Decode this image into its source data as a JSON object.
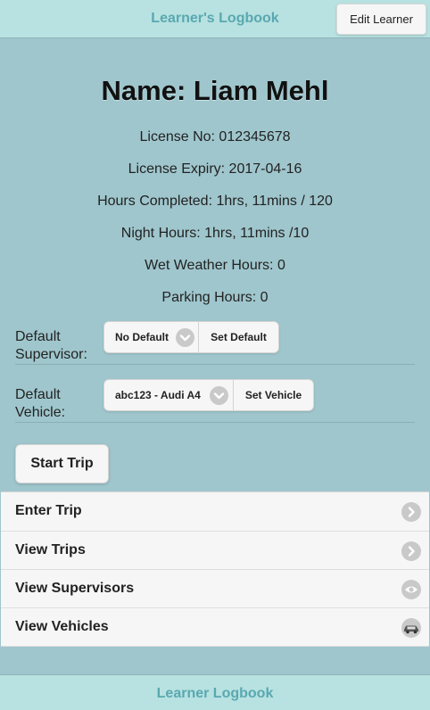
{
  "header": {
    "title": "Learner's Logbook",
    "edit_button": "Edit Learner"
  },
  "profile": {
    "name": "Name: Liam Mehl",
    "license_no": "License No: 012345678",
    "license_expiry": "License Expiry: 2017-04-16",
    "hours_completed": "Hours Completed: 1hrs, 11mins / 120",
    "night_hours": "Night Hours: 1hrs, 11mins /10",
    "wet_weather_hours": "Wet Weather Hours: 0",
    "parking_hours": "Parking Hours: 0"
  },
  "supervisor": {
    "label_line1": "Default",
    "label_line2": "Supervisor:",
    "selected": "No Default",
    "button": "Set Default"
  },
  "vehicle": {
    "label_line1": "Default",
    "label_line2": "Vehicle:",
    "selected": "abc123 - Audi A4",
    "button": "Set Vehicle"
  },
  "start_trip": "Start Trip",
  "menu": [
    {
      "label": "Enter Trip",
      "icon": "chevron-right-icon"
    },
    {
      "label": "View Trips",
      "icon": "chevron-right-icon"
    },
    {
      "label": "View Supervisors",
      "icon": "eye-icon"
    },
    {
      "label": "View Vehicles",
      "icon": "car-icon"
    }
  ],
  "footer": {
    "title": "Learner Logbook"
  }
}
